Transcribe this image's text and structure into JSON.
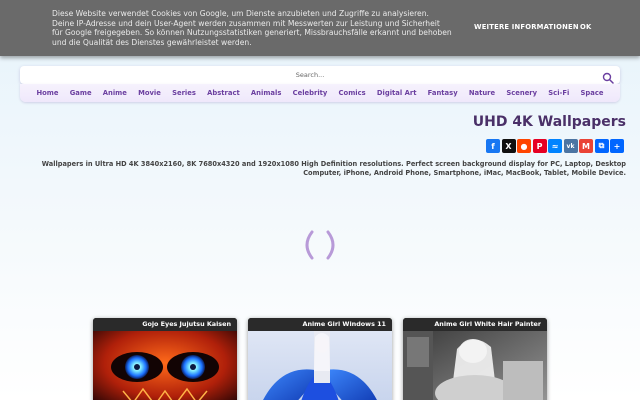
{
  "cookie": {
    "text": "Diese Website verwendet Cookies von Google, um Dienste anzubieten und Zugriffe zu analysieren. Deine IP-Adresse und dein User-Agent werden zusammen mit Messwerten zur Leistung und Sicherheit für Google freigegeben. So können Nutzungsstatistiken generiert, Missbrauchsfälle erkannt und behoben und die Qualität des Dienstes gewährleistet werden.",
    "more_label": "WEITERE INFORMATIONEN",
    "ok_label": "OK"
  },
  "search": {
    "placeholder": "Search...",
    "icon": "search-icon"
  },
  "nav": {
    "items": [
      "Home",
      "Game",
      "Anime",
      "Movie",
      "Series",
      "Abstract",
      "Animals",
      "Celebrity",
      "Comics",
      "Digital Art",
      "Fantasy",
      "Nature",
      "Scenery",
      "Sci-Fi",
      "Space"
    ]
  },
  "site": {
    "title": "UHD 4K Wallpapers",
    "description_line1": "Wallpapers in Ultra HD 4K 3840x2160, 8K 7680x4320 and 1920x1080 High Definition resolutions. Perfect screen background display for PC, Laptop, Desktop",
    "description_line2": "Computer, iPhone, Android Phone, Smartphone, iMac, MacBook, Tablet, Mobile Device."
  },
  "share": {
    "buttons": [
      {
        "name": "facebook",
        "glyph": "f",
        "color": "#1877f2"
      },
      {
        "name": "x",
        "glyph": "X",
        "color": "#111111"
      },
      {
        "name": "reddit",
        "glyph": "r",
        "color": "#ff4500"
      },
      {
        "name": "pinterest",
        "glyph": "P",
        "color": "#e60023"
      },
      {
        "name": "messenger",
        "glyph": "m",
        "color": "#0084ff"
      },
      {
        "name": "vk",
        "glyph": "vk",
        "color": "#4c75a3"
      },
      {
        "name": "gmail",
        "glyph": "M",
        "color": "#ea4335"
      },
      {
        "name": "copy-link",
        "glyph": "⧉",
        "color": "#0166ff"
      },
      {
        "name": "share",
        "glyph": "+",
        "color": "#0166ff"
      }
    ]
  },
  "cards": [
    {
      "title": "Gojo Eyes Jujutsu Kaisen"
    },
    {
      "title": "Anime Girl Windows 11"
    },
    {
      "title": "Anime Girl White Hair Painter"
    }
  ],
  "colors": {
    "accent": "#6b3fa0",
    "cookie_bg": "#6a6a6a"
  }
}
